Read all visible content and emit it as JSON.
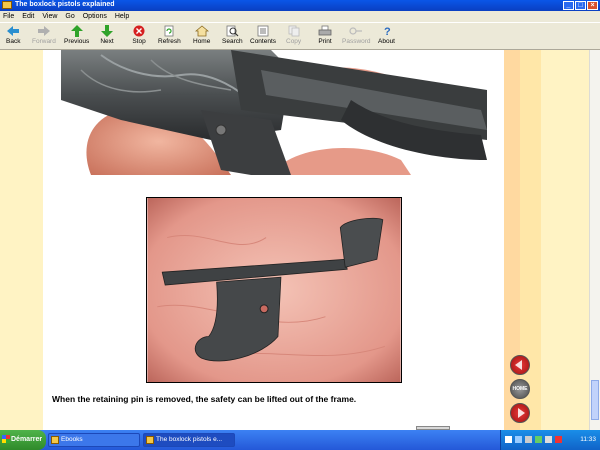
{
  "window": {
    "title": "The boxlock pistols explained"
  },
  "menu": [
    "File",
    "Edit",
    "View",
    "Go",
    "Options",
    "Help"
  ],
  "toolbar": {
    "back": "Back",
    "forward": "Forward",
    "previous": "Previous",
    "next": "Next",
    "stop": "Stop",
    "refresh": "Refresh",
    "home": "Home",
    "search": "Search",
    "contents": "Contents",
    "copy": "Copy",
    "print": "Print",
    "password": "Password",
    "about": "About"
  },
  "content": {
    "caption": "When the retaining pin is removed, the safety can be lifted out of the frame.",
    "nav_home_label": "HOME"
  },
  "taskbar": {
    "start": "Démarrer",
    "items": [
      "Ebooks",
      "The boxlock pistols e..."
    ],
    "clock": "11:33"
  },
  "colors": {
    "accent": "#0a56e8",
    "nav_button": "#c81818",
    "page_stripe": "#ffe7a8"
  }
}
